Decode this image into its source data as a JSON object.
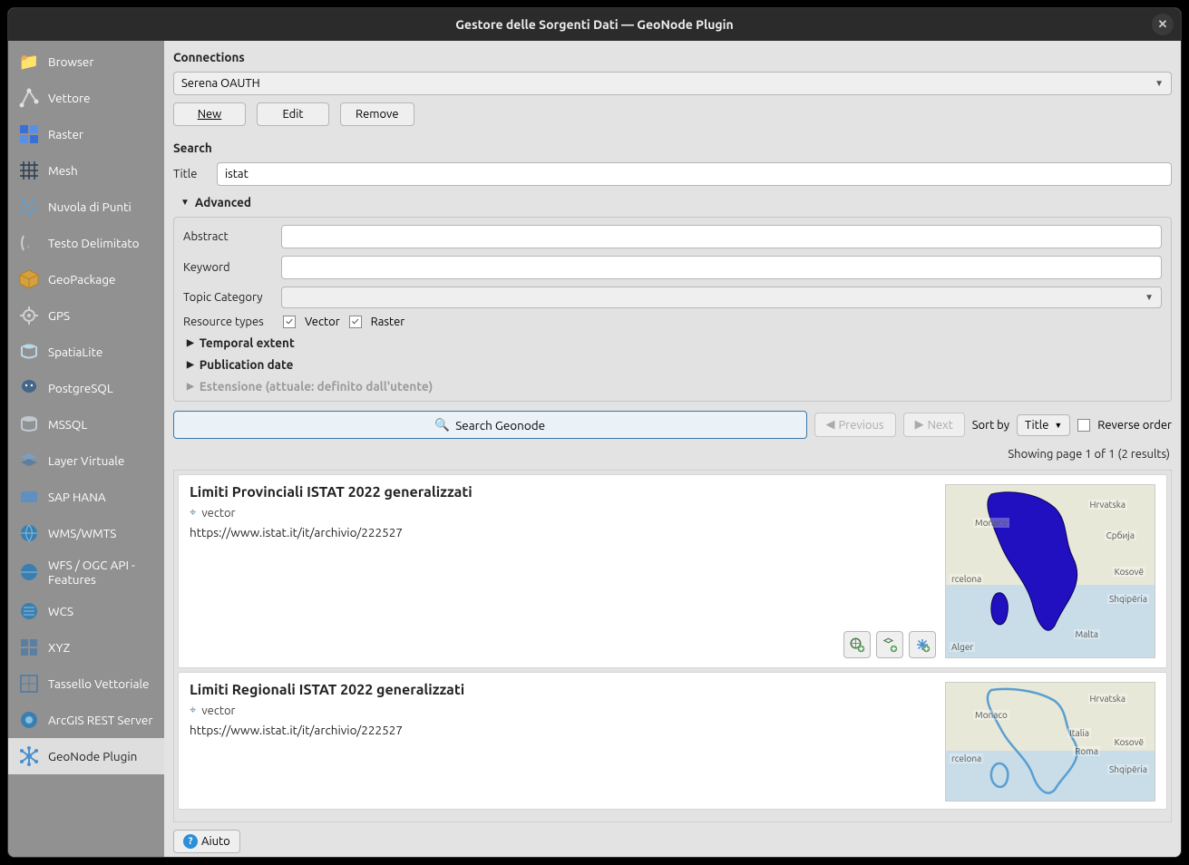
{
  "window": {
    "title": "Gestore delle Sorgenti Dati — GeoNode Plugin"
  },
  "sidebar": {
    "items": [
      {
        "label": "Browser"
      },
      {
        "label": "Vettore"
      },
      {
        "label": "Raster"
      },
      {
        "label": "Mesh"
      },
      {
        "label": "Nuvola di Punti"
      },
      {
        "label": "Testo Delimitato"
      },
      {
        "label": "GeoPackage"
      },
      {
        "label": "GPS"
      },
      {
        "label": "SpatiaLite"
      },
      {
        "label": "PostgreSQL"
      },
      {
        "label": "MSSQL"
      },
      {
        "label": "Layer Virtuale"
      },
      {
        "label": "SAP HANA"
      },
      {
        "label": "WMS/WMTS"
      },
      {
        "label": "WFS / OGC API - Features"
      },
      {
        "label": "WCS"
      },
      {
        "label": "XYZ"
      },
      {
        "label": "Tassello Vettoriale"
      },
      {
        "label": "ArcGIS REST Server"
      },
      {
        "label": "GeoNode Plugin"
      }
    ]
  },
  "connections": {
    "heading": "Connections",
    "selected": "Serena OAUTH",
    "new_label": "New",
    "edit_label": "Edit",
    "remove_label": "Remove"
  },
  "search": {
    "heading": "Search",
    "title_label": "Title",
    "title_value": "istat",
    "advanced_label": "Advanced",
    "abstract_label": "Abstract",
    "abstract_value": "",
    "keyword_label": "Keyword",
    "keyword_value": "",
    "topic_label": "Topic Category",
    "topic_value": "",
    "resource_types_label": "Resource types",
    "vector_label": "Vector",
    "raster_label": "Raster",
    "temporal_label": "Temporal extent",
    "publication_label": "Publication date",
    "extent_label": "Estensione (attuale: definito dall'utente)"
  },
  "toolbar": {
    "search_button": "Search Geonode",
    "previous": "Previous",
    "next": "Next",
    "sort_by": "Sort by",
    "sort_value": "Title",
    "reverse": "Reverse order",
    "status": "Showing page 1 of 1 (2 results)"
  },
  "results": [
    {
      "title": "Limiti Provinciali ISTAT 2022 generalizzati",
      "type": "vector",
      "link": "https://www.istat.it/it/archivio/222527"
    },
    {
      "title": "Limiti Regionali ISTAT 2022 generalizzati",
      "type": "vector",
      "link": "https://www.istat.it/it/archivio/222527"
    }
  ],
  "footer": {
    "help": "Aiuto"
  }
}
